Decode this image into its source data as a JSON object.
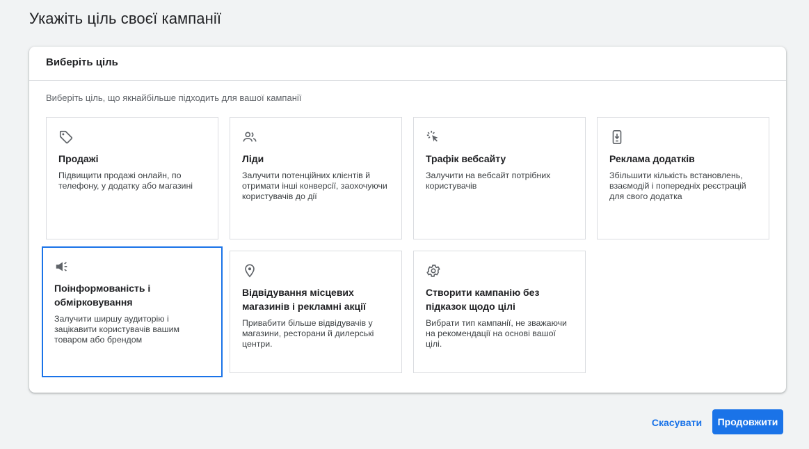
{
  "page": {
    "title": "Укажіть ціль своєї кампанії"
  },
  "panel": {
    "header": "Виберіть ціль",
    "instruction": "Виберіть ціль, що якнайбільше підходить для вашої кампанії"
  },
  "goals": [
    {
      "icon": "tag-icon",
      "title": "Продажі",
      "description": "Підвищити продажі онлайн, по телефону, у додатку або магазині"
    },
    {
      "icon": "people-icon",
      "title": "Ліди",
      "description": "Залучити потенційних клієнтів й отримати інші конверсії, заохочуючи користувачів до дії"
    },
    {
      "icon": "cursor-click-icon",
      "title": "Трафік вебсайту",
      "description": "Залучити на вебсайт потрібних користувачів"
    },
    {
      "icon": "phone-download-icon",
      "title": "Реклама додатків",
      "description": "Збільшити кількість встановлень, взаємодій і попередніх реєстрацій для свого додатка"
    },
    {
      "icon": "megaphone-icon",
      "title": "Поінформованість і обмірковування",
      "description": "Залучити ширшу аудиторію і зацікавити користувачів вашим товаром або брендом",
      "selected": true
    },
    {
      "icon": "location-pin-icon",
      "title": "Відвідування місцевих магазинів і рекламні акції",
      "description": "Привабити більше відвідувачів у магазини, ресторани й дилерські центри."
    },
    {
      "icon": "gear-icon",
      "title": "Створити кампанію без підказок щодо цілі",
      "description": "Вибрати тип кампанії, не зважаючи на рекомендації на основі вашої цілі."
    }
  ],
  "actions": {
    "cancel_label": "Скасувати",
    "continue_label": "Продовжити"
  },
  "colors": {
    "accent": "#1a73e8",
    "background": "#f1f3f4",
    "border": "#dadce0",
    "icon": "#5f6368"
  }
}
